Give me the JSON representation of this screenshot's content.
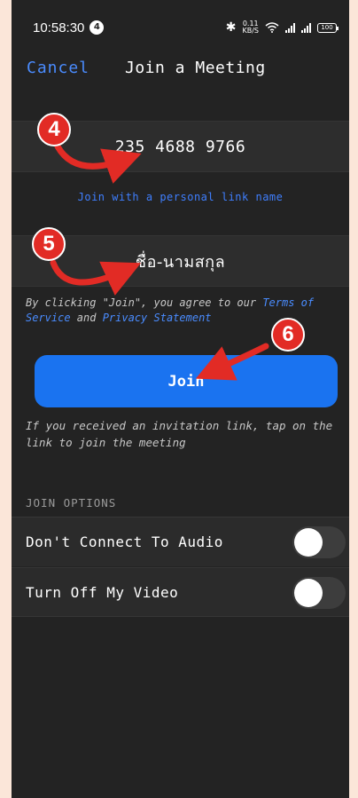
{
  "status_bar": {
    "time": "10:58:30",
    "notification_count": "4",
    "net_speed_value": "0.11",
    "net_speed_unit": "KB/S",
    "battery": "100"
  },
  "nav": {
    "cancel_label": "Cancel",
    "title": "Join a Meeting"
  },
  "meeting_id": "235 4688 9766",
  "personal_link_label": "Join with a personal link name",
  "display_name": "ชื่อ-นามสกุล",
  "terms": {
    "prefix": "By clicking \"Join\", you agree to our ",
    "terms_link": "Terms of Service",
    "and": " and ",
    "privacy_link": "Privacy Statement"
  },
  "join_label": "Join",
  "invite_hint": "If you received an invitation link, tap on the link to join the meeting",
  "join_options": {
    "header": "JOIN OPTIONS",
    "items": [
      {
        "label": "Don't Connect To Audio",
        "enabled": false
      },
      {
        "label": "Turn Off My Video",
        "enabled": false
      }
    ]
  },
  "annotations": {
    "step_meeting_id": "4",
    "step_name": "5",
    "step_join": "6",
    "color": "#e22b25"
  },
  "colors": {
    "accent_blue": "#1a73f0",
    "link_blue": "#4a8cff",
    "background": "#232323"
  }
}
